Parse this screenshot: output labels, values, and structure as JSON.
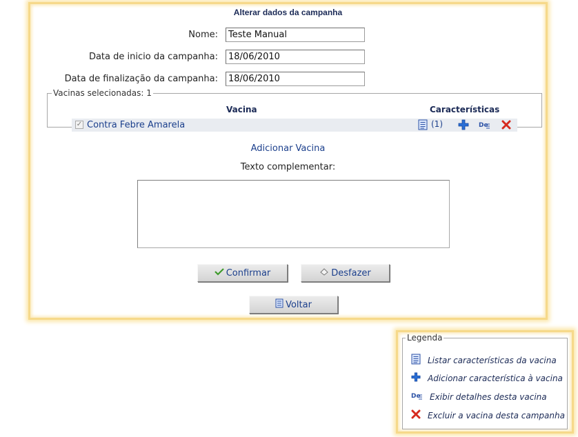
{
  "form": {
    "title": "Alterar dados da campanha",
    "nome_label": "Nome:",
    "nome_value": "Teste Manual",
    "inicio_label": "Data de inicio da campanha:",
    "inicio_value": "18/06/2010",
    "fim_label": "Data de finalização da campanha:",
    "fim_value": "18/06/2010"
  },
  "vacinas": {
    "legend": "Vacinas selecionadas: 1",
    "col_vacina": "Vacina",
    "col_caracteristicas": "Características",
    "rows": [
      {
        "name": "Contra Febre Amarela",
        "checked": true,
        "caracteristicas_count": "(1)"
      }
    ]
  },
  "adicionar_vacina": "Adicionar Vacina",
  "texto_label": "Texto complementar:",
  "texto_value": "",
  "buttons": {
    "confirmar": "Confirmar",
    "desfazer": "Desfazer",
    "voltar": "Voltar"
  },
  "legenda": {
    "title": "Legenda",
    "items": [
      {
        "icon": "list-icon",
        "text": "Listar características da vacina"
      },
      {
        "icon": "plus-icon",
        "text": "Adicionar característica à vacina"
      },
      {
        "icon": "details-icon",
        "text": "Exibir detalhes desta vacina"
      },
      {
        "icon": "delete-icon",
        "text": "Excluir a vacina desta campanha"
      }
    ]
  },
  "colors": {
    "glow_border": "#f6d98a",
    "link": "#1b3f8c",
    "row_bg": "#e9ecf1",
    "delete_red": "#d62a1e",
    "plus_blue": "#2a6fd6"
  }
}
